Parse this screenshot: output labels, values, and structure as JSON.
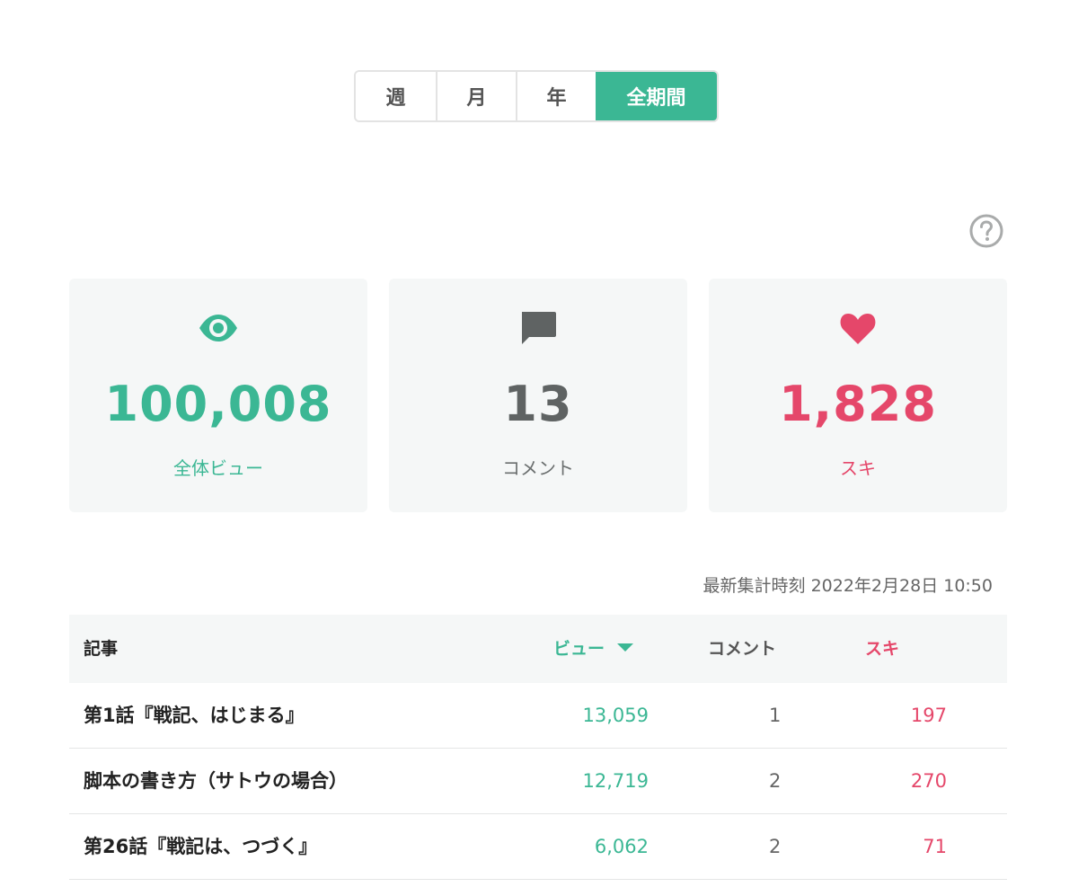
{
  "period_tabs": [
    {
      "label": "週",
      "active": false
    },
    {
      "label": "月",
      "active": false
    },
    {
      "label": "年",
      "active": false
    },
    {
      "label": "全期間",
      "active": true
    }
  ],
  "help": {
    "icon": "question-circle-icon"
  },
  "stats": {
    "views": {
      "value": "100,008",
      "label": "全体ビュー",
      "icon": "eye-icon",
      "color": "#3bb794"
    },
    "comments": {
      "value": "13",
      "label": "コメント",
      "icon": "speech-bubble-icon",
      "color": "#5f6363"
    },
    "likes": {
      "value": "1,828",
      "label": "スキ",
      "icon": "heart-icon",
      "color": "#e5476a"
    }
  },
  "updated_text": "最新集計時刻 2022年2月28日 10:50",
  "table": {
    "headers": {
      "article": "記事",
      "views": "ビュー",
      "comments": "コメント",
      "likes": "スキ"
    },
    "sort_column": "views",
    "sort_direction": "desc",
    "rows": [
      {
        "title": "第1話『戦記、はじまる』",
        "views": "13,059",
        "comments": "1",
        "likes": "197"
      },
      {
        "title": "脚本の書き方（サトウの場合）",
        "views": "12,719",
        "comments": "2",
        "likes": "270"
      },
      {
        "title": "第26話『戦記は、つづく』",
        "views": "6,062",
        "comments": "2",
        "likes": "71"
      }
    ]
  },
  "colors": {
    "accent": "#3bb794",
    "like": "#e5476a",
    "card_bg": "#f5f7f7"
  }
}
